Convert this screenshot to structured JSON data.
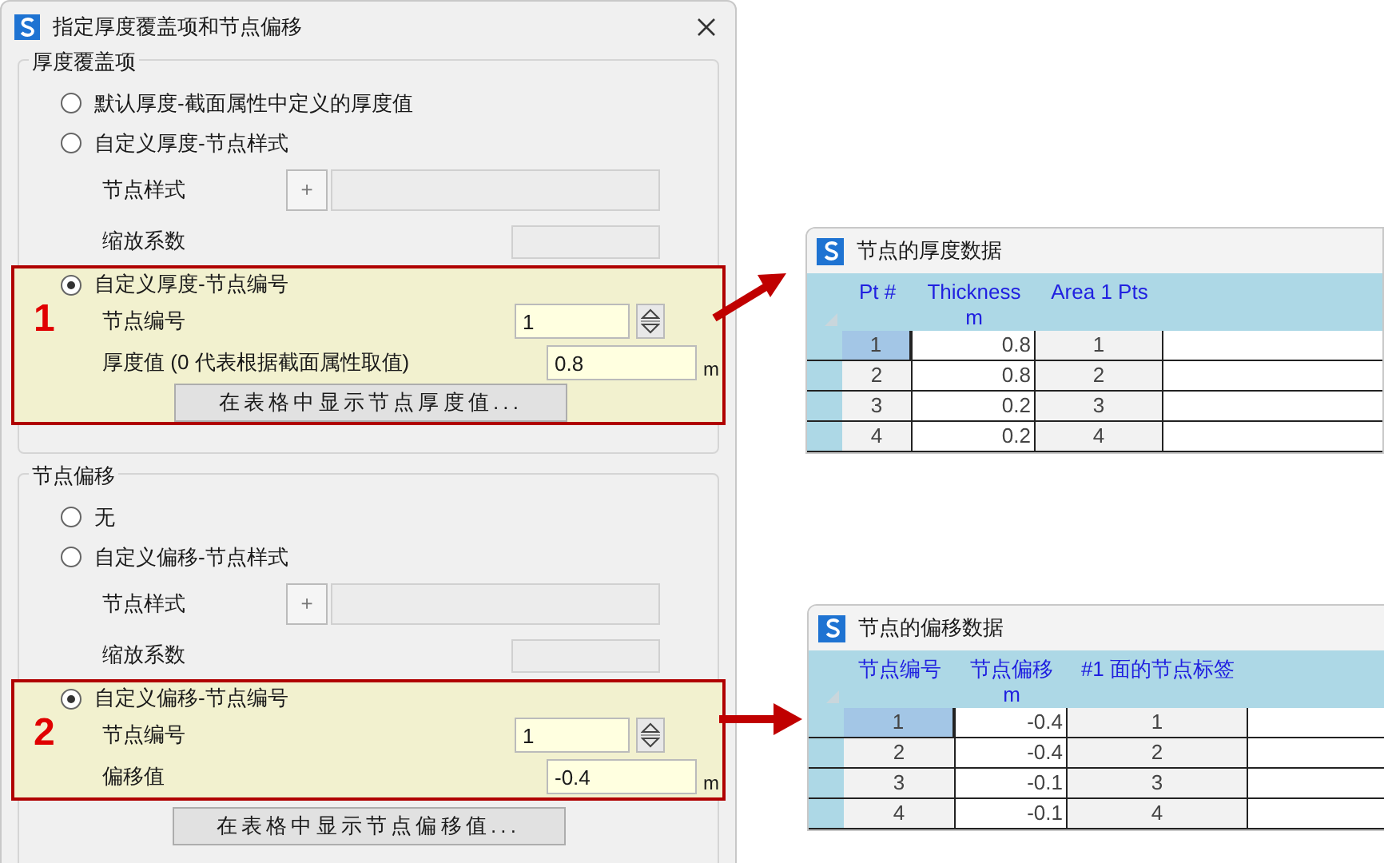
{
  "dialog": {
    "title": "指定厚度覆盖项和节点偏移",
    "groups": [
      {
        "title": "厚度覆盖项",
        "options": [
          {
            "kind": "plain",
            "label": "默认厚度-截面属性中定义的厚度值",
            "selected": false
          },
          {
            "kind": "pattern",
            "label": "自定义厚度-节点样式",
            "selected": false,
            "pattern_label": "节点样式",
            "plus": "+",
            "scale_label": "缩放系数"
          },
          {
            "kind": "node",
            "label": "自定义厚度-节点编号",
            "selected": true,
            "callout": "1",
            "node_label": "节点编号",
            "node_value": "1",
            "value_label": "厚度值 (0 代表根据截面属性取值)",
            "value": "0.8",
            "unit": "m",
            "button": "在表格中显示节点厚度值..."
          }
        ]
      },
      {
        "title": "节点偏移",
        "options": [
          {
            "kind": "plain",
            "label": "无",
            "selected": false
          },
          {
            "kind": "pattern",
            "label": "自定义偏移-节点样式",
            "selected": false,
            "pattern_label": "节点样式",
            "plus": "+",
            "scale_label": "缩放系数"
          },
          {
            "kind": "node",
            "label": "自定义偏移-节点编号",
            "selected": true,
            "callout": "2",
            "node_label": "节点编号",
            "node_value": "1",
            "value_label": "偏移值",
            "value": "-0.4",
            "unit": "m"
          }
        ],
        "button": "在表格中显示节点偏移值..."
      }
    ]
  },
  "tables": [
    {
      "title": "节点的厚度数据",
      "columns": [
        {
          "label": "Pt #"
        },
        {
          "label": "Thickness",
          "unit": "m"
        },
        {
          "label": "Area 1 Pts"
        }
      ],
      "rows": [
        {
          "cells": [
            "1",
            "0.8",
            "1"
          ],
          "selected": true
        },
        {
          "cells": [
            "2",
            "0.8",
            "2"
          ],
          "selected": false
        },
        {
          "cells": [
            "3",
            "0.2",
            "3"
          ],
          "selected": false
        },
        {
          "cells": [
            "4",
            "0.2",
            "4"
          ],
          "selected": false
        }
      ]
    },
    {
      "title": "节点的偏移数据",
      "columns": [
        {
          "label": "节点编号"
        },
        {
          "label": "节点偏移",
          "unit": "m"
        },
        {
          "label": "#1 面的节点标签"
        }
      ],
      "rows": [
        {
          "cells": [
            "1",
            "-0.4",
            "1"
          ],
          "selected": true
        },
        {
          "cells": [
            "2",
            "-0.4",
            "2"
          ],
          "selected": false
        },
        {
          "cells": [
            "3",
            "-0.1",
            "3"
          ],
          "selected": false
        },
        {
          "cells": [
            "4",
            "-0.1",
            "4"
          ],
          "selected": false
        }
      ]
    }
  ]
}
